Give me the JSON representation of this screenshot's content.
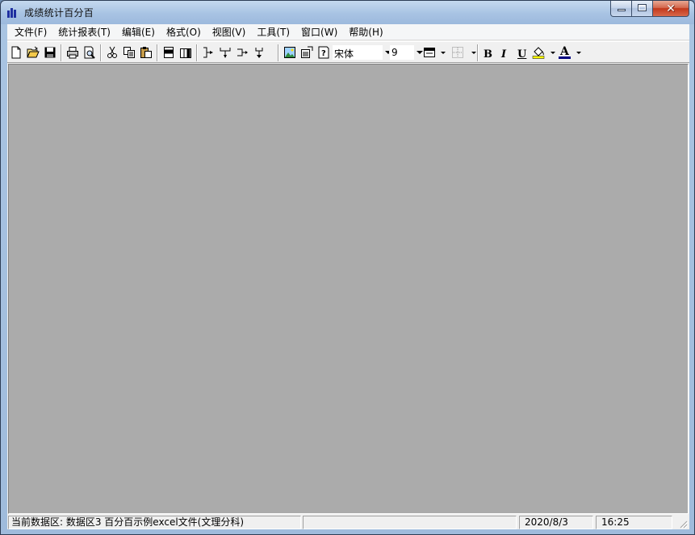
{
  "window": {
    "title": "成绩统计百分百"
  },
  "caption": {
    "minimize_icon": "minimize-icon",
    "maximize_icon": "maximize-icon",
    "close_glyph": "✕"
  },
  "menu": [
    {
      "label": "文件(F)"
    },
    {
      "label": "统计报表(T)"
    },
    {
      "label": "编辑(E)"
    },
    {
      "label": "格式(O)"
    },
    {
      "label": "视图(V)"
    },
    {
      "label": "工具(T)"
    },
    {
      "label": "窗口(W)"
    },
    {
      "label": "帮助(H)"
    }
  ],
  "toolbar": {
    "font_name": "宋体",
    "font_size": "9",
    "bold": "B",
    "italic": "I",
    "underline": "U",
    "font_color": "A"
  },
  "colors": {
    "workspace": "#ababab",
    "font_color_bar": "#000080",
    "fill_color_bar": "#ffff00"
  },
  "status": {
    "current_data": "当前数据区:  数据区3 百分百示例excel文件(文理分科)",
    "date": "2020/8/3",
    "time": "16:25"
  }
}
